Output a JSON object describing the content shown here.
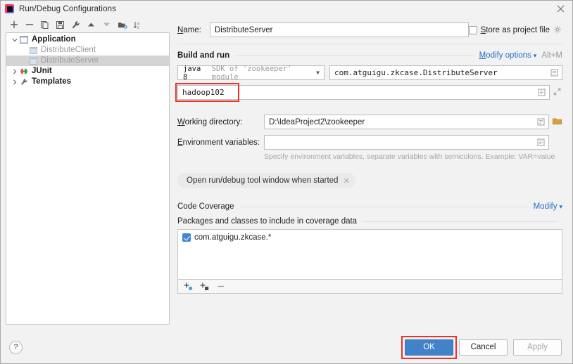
{
  "window": {
    "title": "Run/Debug Configurations",
    "app_icon": "intellij-idea-icon",
    "close_icon": "close-icon"
  },
  "left_panel": {
    "toolbar": [
      {
        "name": "add-configuration-button",
        "icon": "plus-icon",
        "label": "+"
      },
      {
        "name": "remove-configuration-button",
        "icon": "minus-icon",
        "label": "−"
      },
      {
        "name": "copy-configuration-button",
        "icon": "copy-icon",
        "label": "Copy"
      },
      {
        "name": "save-configuration-button",
        "icon": "save-icon",
        "label": "Save"
      },
      {
        "name": "edit-templates-button",
        "icon": "wrench-icon",
        "label": "Edit Templates"
      },
      {
        "name": "move-up-button",
        "icon": "arrow-up-icon",
        "label": "Move Up"
      },
      {
        "name": "move-down-button",
        "icon": "arrow-down-icon",
        "label": "Move Down"
      },
      {
        "name": "move-into-folder-button",
        "icon": "folder-add-icon",
        "label": "Move into new folder"
      },
      {
        "name": "sort-configurations-button",
        "icon": "sort-alpha-icon",
        "label": "Sort Configurations"
      }
    ],
    "tree": [
      {
        "label": "Application",
        "level": 0,
        "expanded": true,
        "twisty": "chevron-down-icon",
        "icon": "application-icon",
        "bold": true,
        "muted": false,
        "selected": false
      },
      {
        "label": "DistributeClient",
        "level": 1,
        "expanded": null,
        "twisty": null,
        "icon": "java-class-icon",
        "bold": false,
        "muted": true,
        "selected": false
      },
      {
        "label": "DistributeServer",
        "level": 1,
        "expanded": null,
        "twisty": null,
        "icon": "java-class-icon",
        "bold": false,
        "muted": true,
        "selected": true
      },
      {
        "label": "JUnit",
        "level": 0,
        "expanded": false,
        "twisty": "chevron-right-icon",
        "icon": "junit-icon",
        "bold": true,
        "muted": false,
        "selected": false
      },
      {
        "label": "Templates",
        "level": 0,
        "expanded": false,
        "twisty": "chevron-right-icon",
        "icon": "wrench-icon",
        "bold": true,
        "muted": false,
        "selected": false
      }
    ]
  },
  "right_panel": {
    "name_label": "Name:",
    "name_mnemonic": "N",
    "name_value": "DistributeServer",
    "store_as_project_file": {
      "label": "Store as project file",
      "mnemonic": "S",
      "checked": false,
      "gear_icon": "gear-icon"
    },
    "build_and_run": {
      "title": "Build and run",
      "modify_options_label": "Modify options",
      "modify_options_mnemonic": "M",
      "modify_options_shortcut": "Alt+M",
      "chevron_icon": "chevron-down-icon",
      "jdk_value": "java 8",
      "jdk_module_text": "SDK of 'zookeeper' module",
      "main_class": "com.atguigu.zkcase.DistributeServer",
      "program_arguments": "hadoop102",
      "expand_icon": "expand-icon",
      "browse_icon": "browse-icon"
    },
    "working_directory": {
      "label": "Working directory:",
      "mnemonic": "W",
      "value": "D:\\IdeaProject2\\zookeeper",
      "browse_icon": "browse-icon",
      "folder_icon": "folder-icon"
    },
    "environment_variables": {
      "label": "Environment variables:",
      "mnemonic": "E",
      "value": "",
      "hint": "Specify environment variables, separate variables with semicolons. Example: VAR=value",
      "browse_icon": "browse-icon"
    },
    "option_chip": {
      "label": "Open run/debug tool window when started",
      "close_icon": "close-icon"
    },
    "code_coverage": {
      "title": "Code Coverage",
      "modify_label": "Modify",
      "chevron_icon": "chevron-down-icon",
      "sub_title": "Packages and classes to include in coverage data",
      "items": [
        {
          "label": "com.atguigu.zkcase.*",
          "checked": true
        }
      ],
      "toolbar": [
        {
          "name": "add-package-button",
          "icon": "add-package-icon",
          "label": "Add package"
        },
        {
          "name": "add-class-button",
          "icon": "add-class-icon",
          "label": "Add class"
        },
        {
          "name": "remove-pattern-button",
          "icon": "minus-icon",
          "label": "Remove"
        }
      ]
    }
  },
  "footer": {
    "help_label": "?",
    "help_icon": "help-icon",
    "ok_label": "OK",
    "cancel_label": "Cancel",
    "apply_label": "Apply",
    "apply_disabled": true
  },
  "highlights": {
    "color": "#e8342a",
    "targets": [
      "program-arguments-field",
      "ok-button"
    ]
  }
}
